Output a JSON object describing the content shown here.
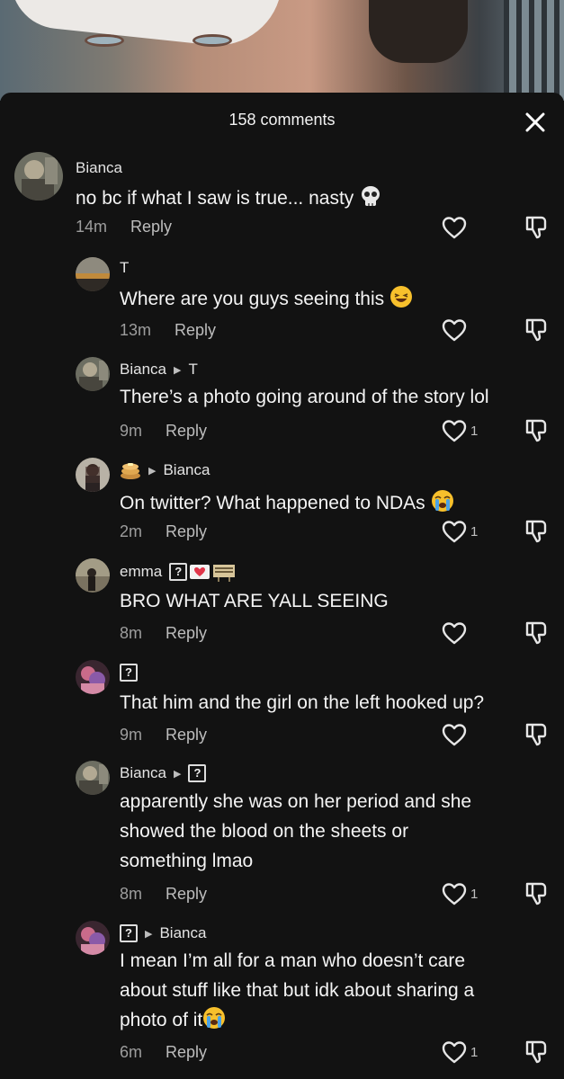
{
  "header": {
    "comment_count": "158 comments"
  },
  "comments": [
    {
      "user": "Bianca",
      "text": "no bc if what I saw is true... nasty",
      "time": "14m",
      "reply": "Reply",
      "likes": ""
    },
    {
      "user": "T",
      "text": "Where are you guys seeing this",
      "time": "13m",
      "reply": "Reply",
      "likes": ""
    },
    {
      "user": "Bianca",
      "reply_to": "T",
      "text": "There’s a photo going around of the story lol",
      "time": "9m",
      "reply": "Reply",
      "likes": "1"
    },
    {
      "reply_to": "Bianca",
      "text": "On twitter? What happened to NDAs",
      "time": "2m",
      "reply": "Reply",
      "likes": "1"
    },
    {
      "user": "emma",
      "text": "BRO WHAT ARE YALL SEEING",
      "time": "8m",
      "reply": "Reply",
      "likes": ""
    },
    {
      "text": "That him and the girl on the left hooked up?",
      "time": "9m",
      "reply": "Reply",
      "likes": ""
    },
    {
      "user": "Bianca",
      "text_lines": [
        "apparently she was on her period and she",
        "showed the blood on the sheets or",
        "something lmao"
      ],
      "time": "8m",
      "reply": "Reply",
      "likes": "1"
    },
    {
      "reply_to": "Bianca",
      "text_lines": [
        "I mean I’m all for a man who doesn’t care",
        "about stuff like that but idk about sharing a",
        "photo of it"
      ],
      "time": "6m",
      "reply": "Reply",
      "likes": "1"
    }
  ],
  "placeholder_glyph": "?",
  "icons": [
    "close-icon",
    "heart-icon",
    "dislike-icon",
    "skull-emoji",
    "laughing-emoji",
    "crying-emoji",
    "pancake-emoji",
    "heart-emoji",
    "sign-emoji"
  ]
}
